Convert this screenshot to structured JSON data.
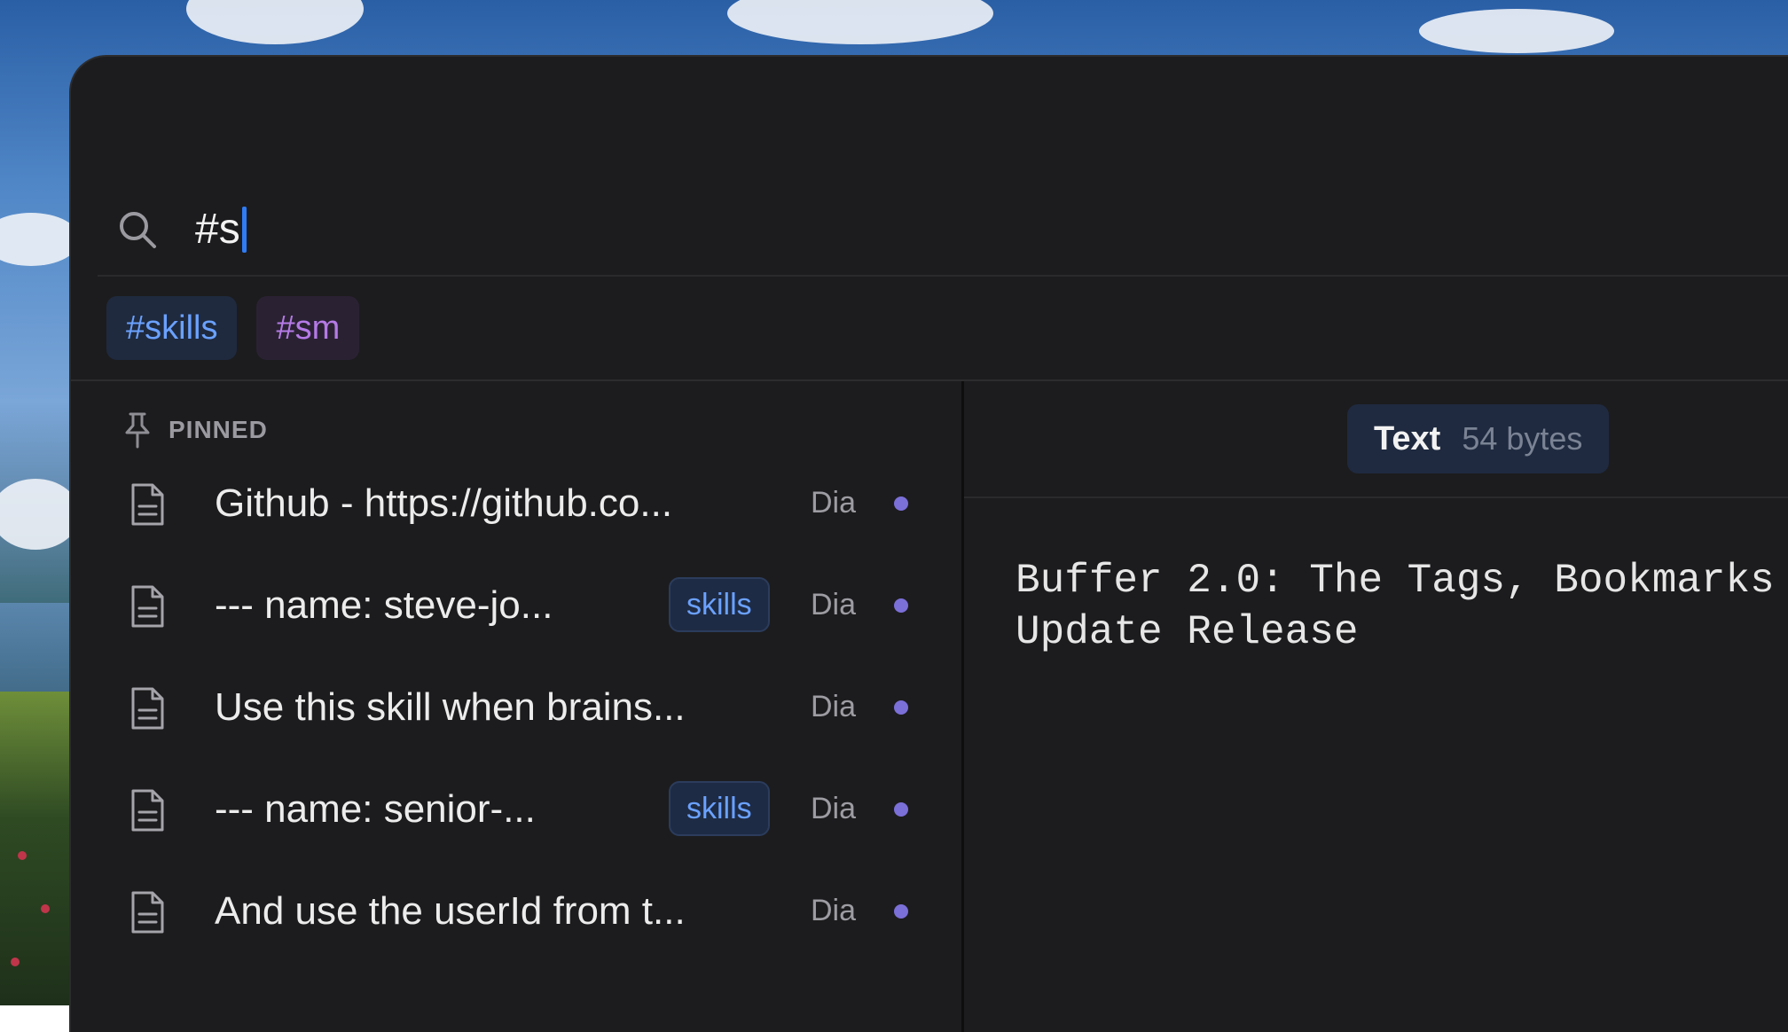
{
  "search": {
    "query": "#s"
  },
  "tag_suggestions": [
    {
      "label": "#skills",
      "color": "#6aa1ff"
    },
    {
      "label": "#sm",
      "color": "#b57ae6"
    }
  ],
  "list": {
    "section_label": "PINNED",
    "items": [
      {
        "title": "Github - https://github.co...",
        "tag": "",
        "app": "Dia"
      },
      {
        "title": "--- name: steve-jo...",
        "tag": "skills",
        "app": "Dia"
      },
      {
        "title": "Use this skill when brains...",
        "tag": "",
        "app": "Dia"
      },
      {
        "title": "--- name: senior-...",
        "tag": "skills",
        "app": "Dia"
      },
      {
        "title": "And use the userId from t...",
        "tag": "",
        "app": "Dia"
      }
    ]
  },
  "preview": {
    "type_label": "Text",
    "size_label": "54 bytes",
    "content": "Buffer 2.0: The Tags, Bookmarks\nUpdate Release"
  },
  "colors": {
    "accent": "#2f7cf6",
    "window_bg": "#1c1c1e",
    "dot": "#7b6fd8"
  }
}
